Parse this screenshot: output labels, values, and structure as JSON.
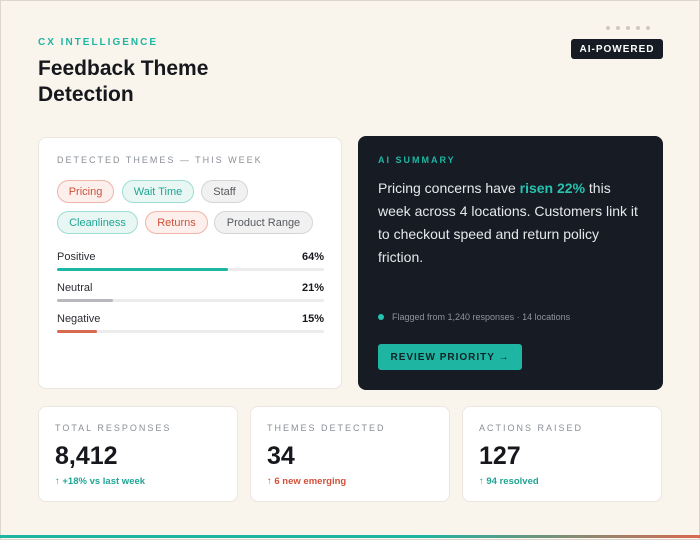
{
  "header": {
    "eyebrow": "CX INTELLIGENCE",
    "title": "Feedback Theme Detection",
    "badge": "AI-POWERED"
  },
  "themes": {
    "label": "DETECTED THEMES — THIS WEEK",
    "chips": [
      {
        "label": "Pricing",
        "tone": "red"
      },
      {
        "label": "Wait Time",
        "tone": "teal"
      },
      {
        "label": "Staff",
        "tone": "grey"
      },
      {
        "label": "Cleanliness",
        "tone": "teal"
      },
      {
        "label": "Returns",
        "tone": "red"
      },
      {
        "label": "Product Range",
        "tone": "grey"
      }
    ],
    "sentiment": [
      {
        "name": "Positive",
        "percent": "64%",
        "value": 64,
        "color": "#1fb5a3"
      },
      {
        "name": "Neutral",
        "percent": "21%",
        "value": 21,
        "color": "#b8b8be"
      },
      {
        "name": "Negative",
        "percent": "15%",
        "value": 15,
        "color": "#d7694f"
      }
    ]
  },
  "summary": {
    "label": "AI SUMMARY",
    "text_before": "Pricing concerns have ",
    "highlight": "risen 22%",
    "text_after": " this week across 4 locations. Customers link it to checkout speed and return policy friction.",
    "meta": "Flagged from 1,240 responses · 14 locations",
    "button": "REVIEW PRIORITY →"
  },
  "stats": [
    {
      "label": "TOTAL RESPONSES",
      "value": "8,412",
      "delta": "↑ +18% vs last week",
      "tone": "up-teal"
    },
    {
      "label": "THEMES DETECTED",
      "value": "34",
      "delta": "↑ 6 new emerging",
      "tone": "up-red"
    },
    {
      "label": "ACTIONS RAISED",
      "value": "127",
      "delta": "↑ 94 resolved",
      "tone": "up-teal"
    }
  ],
  "colors": {
    "accent": "#1fb5a3",
    "alert": "#d1503a",
    "panel_dark": "#161b24",
    "background": "#f9f4ec"
  }
}
